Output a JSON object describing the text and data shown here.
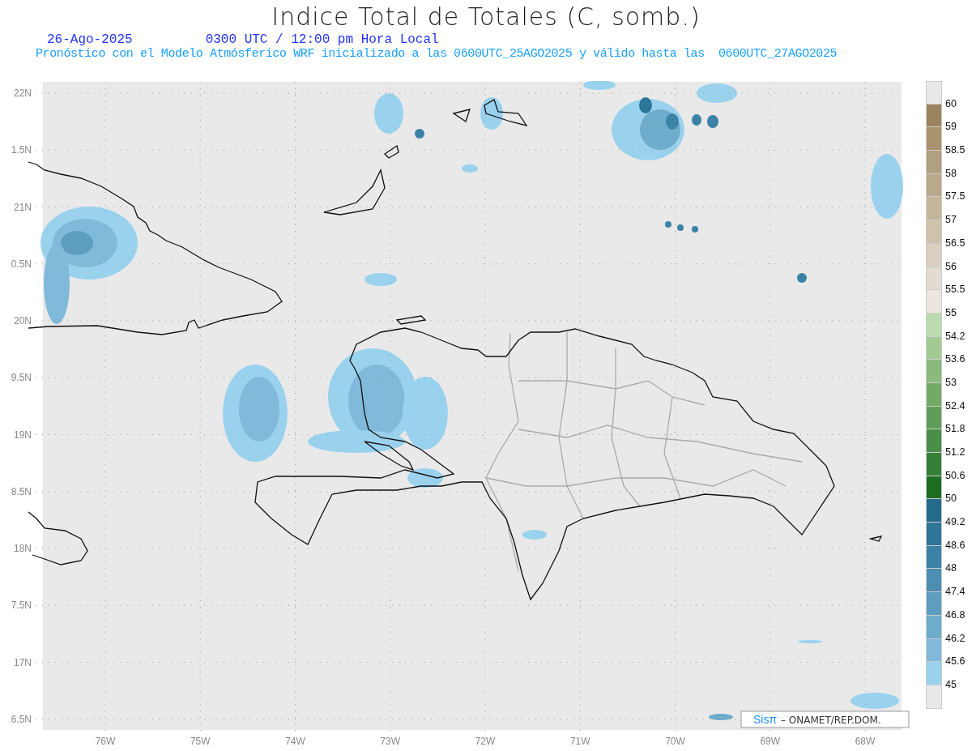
{
  "title": "Indice Total de Totales (C, somb.)",
  "date": "26-Ago-2025",
  "time": "0300 UTC / 12:00 pm Hora Local",
  "forecast_note": "Pronóstico con el Modelo Atmósferico WRF inicializado a las 0600UTC_25AGO2025 y válido hasta las  0600UTC_27AGO2025",
  "map": {
    "lat_labels": [
      "22N",
      "1.5N",
      "21N",
      "0.5N",
      "20N",
      "9.5N",
      "19N",
      "8.5N",
      "18N",
      "7.5N",
      "17N",
      "6.5N"
    ],
    "lon_labels": [
      "76W",
      "75W",
      "74W",
      "73W",
      "72W",
      "71W",
      "70W",
      "69W",
      "68W"
    ],
    "credit": {
      "brand": "Sisπ",
      "text": "– ONAMET/REP.DOM."
    }
  },
  "colorbar": [
    {
      "label": "60",
      "color": "#9a8560"
    },
    {
      "label": "59",
      "color": "#a8936e"
    },
    {
      "label": "58.5",
      "color": "#b09f80"
    },
    {
      "label": "58",
      "color": "#b9a98b"
    },
    {
      "label": "57.5",
      "color": "#c4b59b"
    },
    {
      "label": "57",
      "color": "#cfc2ab"
    },
    {
      "label": "56.5",
      "color": "#d9cfbe"
    },
    {
      "label": "56",
      "color": "#e2dbd0"
    },
    {
      "label": "55.5",
      "color": "#ebe7df"
    },
    {
      "label": "55",
      "color": "#b9dbad"
    },
    {
      "label": "54.2",
      "color": "#a1cb93"
    },
    {
      "label": "53.6",
      "color": "#8abb7c"
    },
    {
      "label": "53",
      "color": "#73ab66"
    },
    {
      "label": "52.4",
      "color": "#5f9e58"
    },
    {
      "label": "51.8",
      "color": "#4a8e47"
    },
    {
      "label": "51.2",
      "color": "#357e37"
    },
    {
      "label": "50.6",
      "color": "#1d6e21"
    },
    {
      "label": "50",
      "color": "#236a8b"
    },
    {
      "label": "49.2",
      "color": "#2d7599"
    },
    {
      "label": "48.6",
      "color": "#3b82a7"
    },
    {
      "label": "48",
      "color": "#4c8fb3"
    },
    {
      "label": "47.4",
      "color": "#5c9dc0"
    },
    {
      "label": "46.8",
      "color": "#6eaccc"
    },
    {
      "label": "46.2",
      "color": "#80b9d9"
    },
    {
      "label": "45.6",
      "color": "#9ad2ee"
    },
    {
      "label": "45",
      "color": "#e8e8e8"
    }
  ]
}
